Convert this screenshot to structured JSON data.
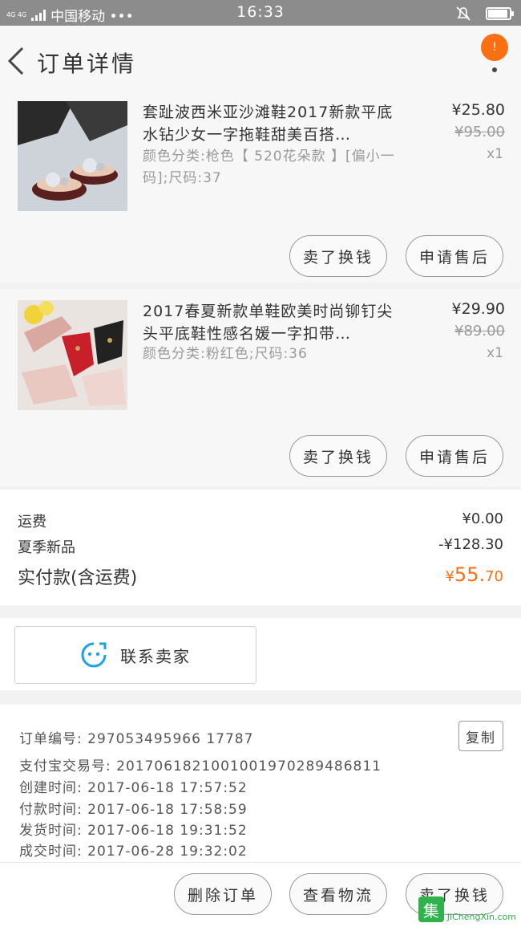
{
  "status_bar": {
    "network": "4G 4G",
    "carrier": "中国移动 •••",
    "time": "16:33"
  },
  "header": {
    "title": "订单详情",
    "badge_count": "!"
  },
  "items": [
    {
      "name": "套趾波西米亚沙滩鞋2017新款平底水钻少女一字拖鞋甜美百搭…",
      "spec": "颜色分类:枪色【 520花朵款 】[偏小一码];尺码:37",
      "price": "¥25.80",
      "original_price": "¥95.00",
      "qty": "x1",
      "btn_sell": "卖了换钱",
      "btn_aftersale": "申请售后"
    },
    {
      "name": "2017春夏新款单鞋欧美时尚铆钉尖头平底鞋性感名媛一字扣带…",
      "spec": "颜色分类:粉红色;尺码:36",
      "price": "¥29.90",
      "original_price": "¥89.00",
      "qty": "x1",
      "btn_sell": "卖了换钱",
      "btn_aftersale": "申请售后"
    }
  ],
  "summary": {
    "shipping_label": "运费",
    "shipping_value": "¥0.00",
    "promo_label": "夏季新品",
    "promo_value": "-¥128.30",
    "paid_label": "实付款(含运费)",
    "paid_currency": "¥",
    "paid_int": "55.",
    "paid_dec": "70"
  },
  "contact": {
    "label": "联系卖家",
    "icon": "chat-face-icon"
  },
  "order_info": {
    "order_no": "订单编号: 297053495966 17787",
    "alipay_no": "支付宝交易号: 2017061821001001970289486811",
    "created": "创建时间: 2017-06-18  17:57:52",
    "paid": "付款时间: 2017-06-18  17:58:59",
    "shipped": "发货时间: 2017-06-18  19:31:52",
    "completed": "成交时间: 2017-06-28  19:32:02",
    "copy_label": "复制"
  },
  "bottom": {
    "delete": "删除订单",
    "logistics": "查看物流",
    "sell": "卖了换钱"
  },
  "watermark": {
    "logo": "集",
    "text": "JiChengXin.com"
  },
  "colors": {
    "accent": "#f96f12",
    "contact_icon": "#1aa3e8",
    "watermark": "#2fb24c"
  }
}
